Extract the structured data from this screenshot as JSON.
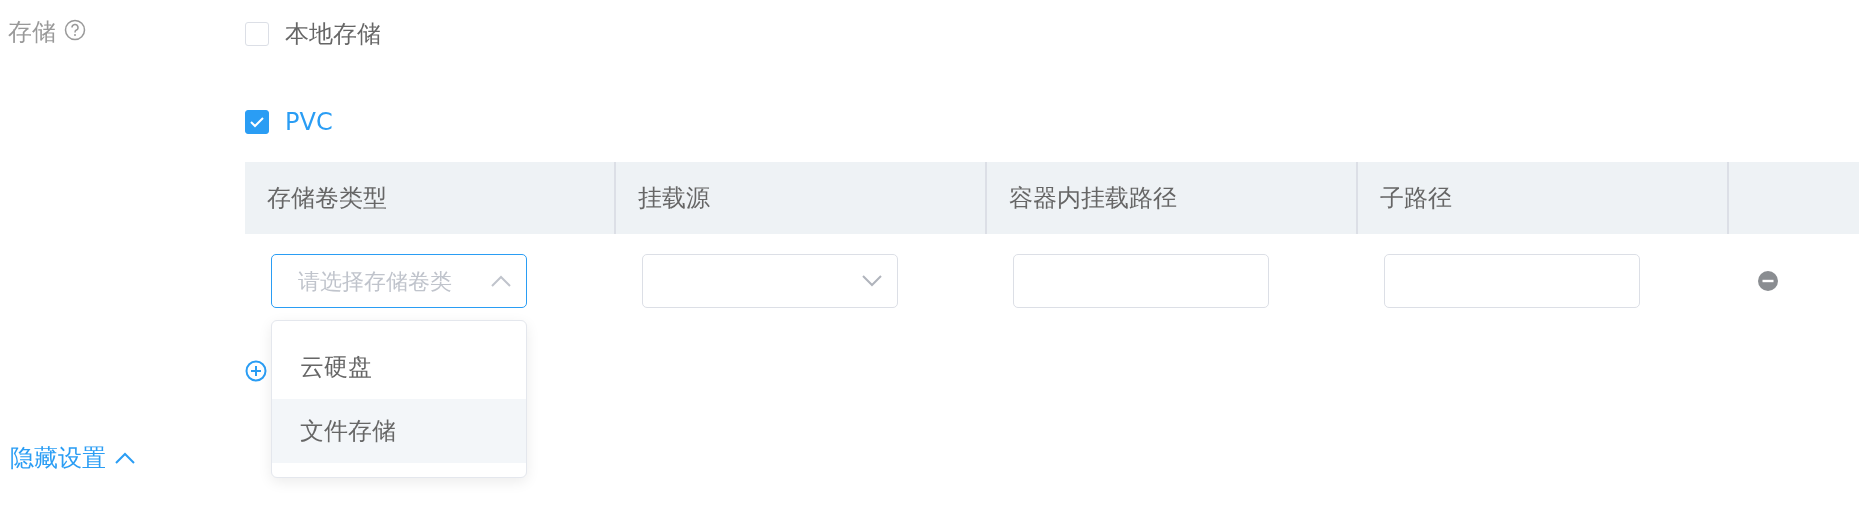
{
  "storage": {
    "label": "存储",
    "options": [
      {
        "label": "本地存储",
        "checked": false
      },
      {
        "label": "PVC",
        "checked": true
      }
    ],
    "table": {
      "columns": [
        "存储卷类型",
        "挂载源",
        "容器内挂载路径",
        "子路径"
      ],
      "rows": [
        {
          "cells": [
            {
              "kind": "select",
              "placeholder": "请选择存储卷类",
              "expanded": true
            },
            {
              "kind": "select",
              "expanded": false
            },
            {
              "kind": "input"
            },
            {
              "kind": "input"
            }
          ]
        }
      ]
    },
    "dropdown": {
      "options": [
        {
          "label": "云硬盘",
          "selected": false
        },
        {
          "label": "文件存储",
          "selected": true
        }
      ]
    }
  },
  "toggle": {
    "label": "隐藏设置",
    "expanded": true
  }
}
